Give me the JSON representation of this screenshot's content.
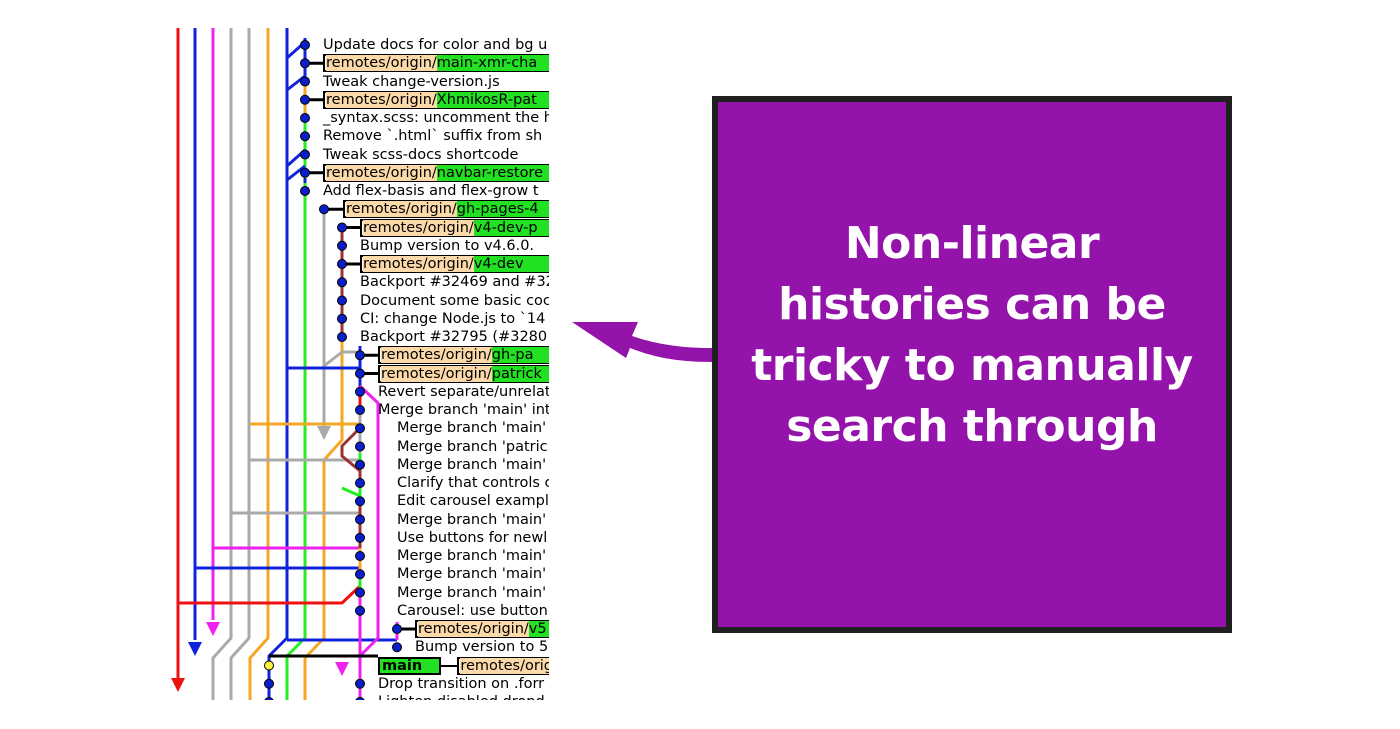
{
  "callout": {
    "text": "Non-linear histories can be tricky to manually search through",
    "background": "#9413aa",
    "border": "#1f1f1f",
    "text_color": "#ffffff"
  },
  "arrow": {
    "color": "#9413aa",
    "direction": "pointing-left-toward-graph"
  },
  "graph": {
    "ref_prefix": "remotes/origin/",
    "colors": {
      "red": "#ee1111",
      "blue": "#1122dd",
      "magenta": "#ee22ee",
      "gray": "#aaaaaa",
      "orange": "#f5a623",
      "green": "#22ee22",
      "brown": "#993333",
      "node": "#0a1fc8",
      "head_node": "#ffee44",
      "ref_prefix_bg": "#fcd9a8",
      "ref_branch_bg": "#22e022"
    },
    "rows": [
      {
        "type": "commit",
        "indent": 0,
        "text": "Update docs for color and bg u"
      },
      {
        "type": "ref",
        "indent": 0,
        "branch": "main-xmr-cha"
      },
      {
        "type": "commit",
        "indent": 0,
        "text": "Tweak change-version.js"
      },
      {
        "type": "ref",
        "indent": 0,
        "branch": "XhmikosR-pat"
      },
      {
        "type": "commit",
        "indent": 0,
        "text": "_syntax.scss: uncomment the h"
      },
      {
        "type": "commit",
        "indent": 0,
        "text": "Remove `.html` suffix from sh"
      },
      {
        "type": "commit",
        "indent": 0,
        "text": "Tweak scss-docs shortcode"
      },
      {
        "type": "ref",
        "indent": 0,
        "branch": "navbar-restore"
      },
      {
        "type": "commit",
        "indent": 0,
        "text": "Add flex-basis and flex-grow t"
      },
      {
        "type": "ref",
        "indent": 1,
        "branch": "gh-pages-4"
      },
      {
        "type": "ref",
        "indent": 2,
        "branch": "v4-dev-p"
      },
      {
        "type": "commit",
        "indent": 2,
        "text": "Bump version to v4.6.0."
      },
      {
        "type": "ref",
        "indent": 2,
        "branch": "v4-dev"
      },
      {
        "type": "commit",
        "indent": 2,
        "text": "Backport #32469 and #32"
      },
      {
        "type": "commit",
        "indent": 2,
        "text": "Document some basic coc"
      },
      {
        "type": "commit",
        "indent": 2,
        "text": "CI: change Node.js to `14"
      },
      {
        "type": "commit",
        "indent": 2,
        "text": "Backport #32795 (#3280"
      },
      {
        "type": "ref",
        "indent": 3,
        "branch": "gh-pa"
      },
      {
        "type": "ref",
        "indent": 3,
        "branch": "patrick"
      },
      {
        "type": "commit",
        "indent": 3,
        "text": "Revert separate/unrelat"
      },
      {
        "type": "commit",
        "indent": 3,
        "text": "Merge branch 'main' int"
      },
      {
        "type": "commit",
        "indent": 4,
        "text": "Merge branch 'main'"
      },
      {
        "type": "commit",
        "indent": 4,
        "text": "Merge branch 'patric"
      },
      {
        "type": "commit",
        "indent": 4,
        "text": "Merge branch 'main'"
      },
      {
        "type": "commit",
        "indent": 4,
        "text": "Clarify that controls c"
      },
      {
        "type": "commit",
        "indent": 4,
        "text": "Edit carousel exampl"
      },
      {
        "type": "commit",
        "indent": 4,
        "text": "Merge branch 'main'"
      },
      {
        "type": "commit",
        "indent": 4,
        "text": "Use buttons for newl"
      },
      {
        "type": "commit",
        "indent": 4,
        "text": "Merge branch 'main'"
      },
      {
        "type": "commit",
        "indent": 4,
        "text": "Merge branch 'main'"
      },
      {
        "type": "commit",
        "indent": 4,
        "text": "Merge branch 'main'"
      },
      {
        "type": "commit",
        "indent": 4,
        "text": "Carousel: use button"
      },
      {
        "type": "ref",
        "indent": 5,
        "branch": "v5"
      },
      {
        "type": "commit",
        "indent": 5,
        "text": "Bump version to 5"
      },
      {
        "type": "head",
        "indent": 3,
        "local": "main",
        "branch": ""
      },
      {
        "type": "commit",
        "indent": 3,
        "text": "Drop transition on .forr"
      },
      {
        "type": "commit",
        "indent": 3,
        "text": "Lighten disabled dropd"
      }
    ]
  }
}
